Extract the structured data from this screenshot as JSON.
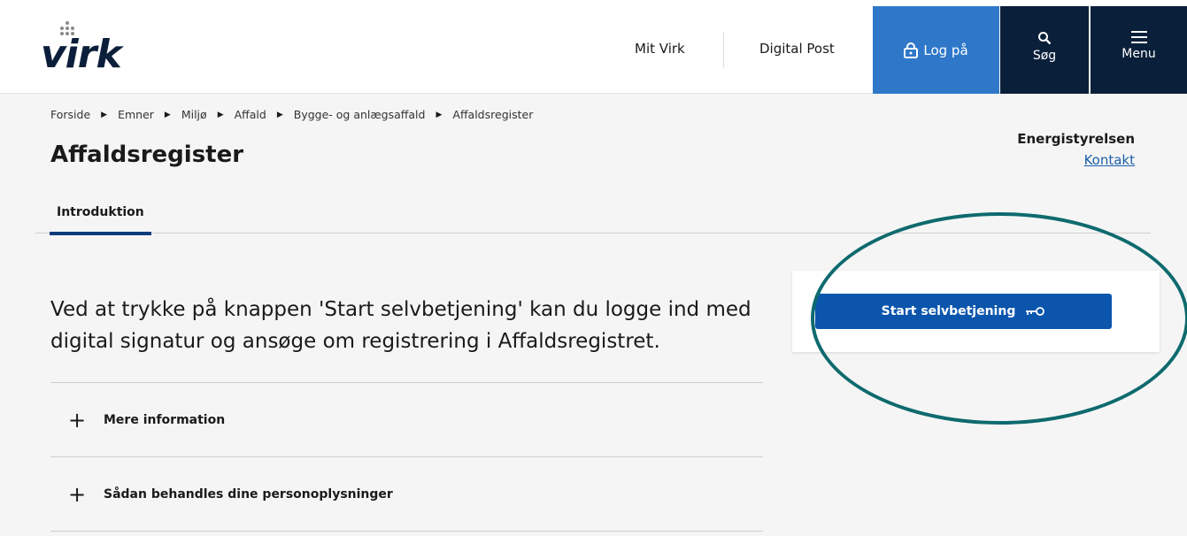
{
  "header": {
    "logo_text": "virk",
    "nav": {
      "mit_virk": "Mit Virk",
      "digital_post": "Digital Post"
    },
    "login_label": "Log på",
    "search_label": "Søg",
    "menu_label": "Menu"
  },
  "breadcrumb": [
    "Forside",
    "Emner",
    "Miljø",
    "Affald",
    "Bygge- og anlægsaffald",
    "Affaldsregister"
  ],
  "page": {
    "title": "Affaldsregister",
    "agency": "Energistyrelsen",
    "contact_link": "Kontakt"
  },
  "tabs": [
    "Introduktion"
  ],
  "main": {
    "intro_text": "Ved at trykke på knappen 'Start selvbetjening' kan du logge ind med digital signatur og ansøge om registrering i Affaldsregistret.",
    "accordions": [
      {
        "label": "Mere information"
      },
      {
        "label": "Sådan behandles dine personoplysninger"
      }
    ],
    "start_button_label": "Start selvbetjening"
  },
  "colors": {
    "login_blue": "#2f78c9",
    "header_navy": "#0a1f3a",
    "primary_button": "#0b55ad",
    "highlight_ring": "#0e6a6e"
  },
  "icons": [
    "lock-icon",
    "search-icon",
    "menu-icon",
    "key-icon",
    "plus-icon",
    "breadcrumb-arrow-icon"
  ]
}
